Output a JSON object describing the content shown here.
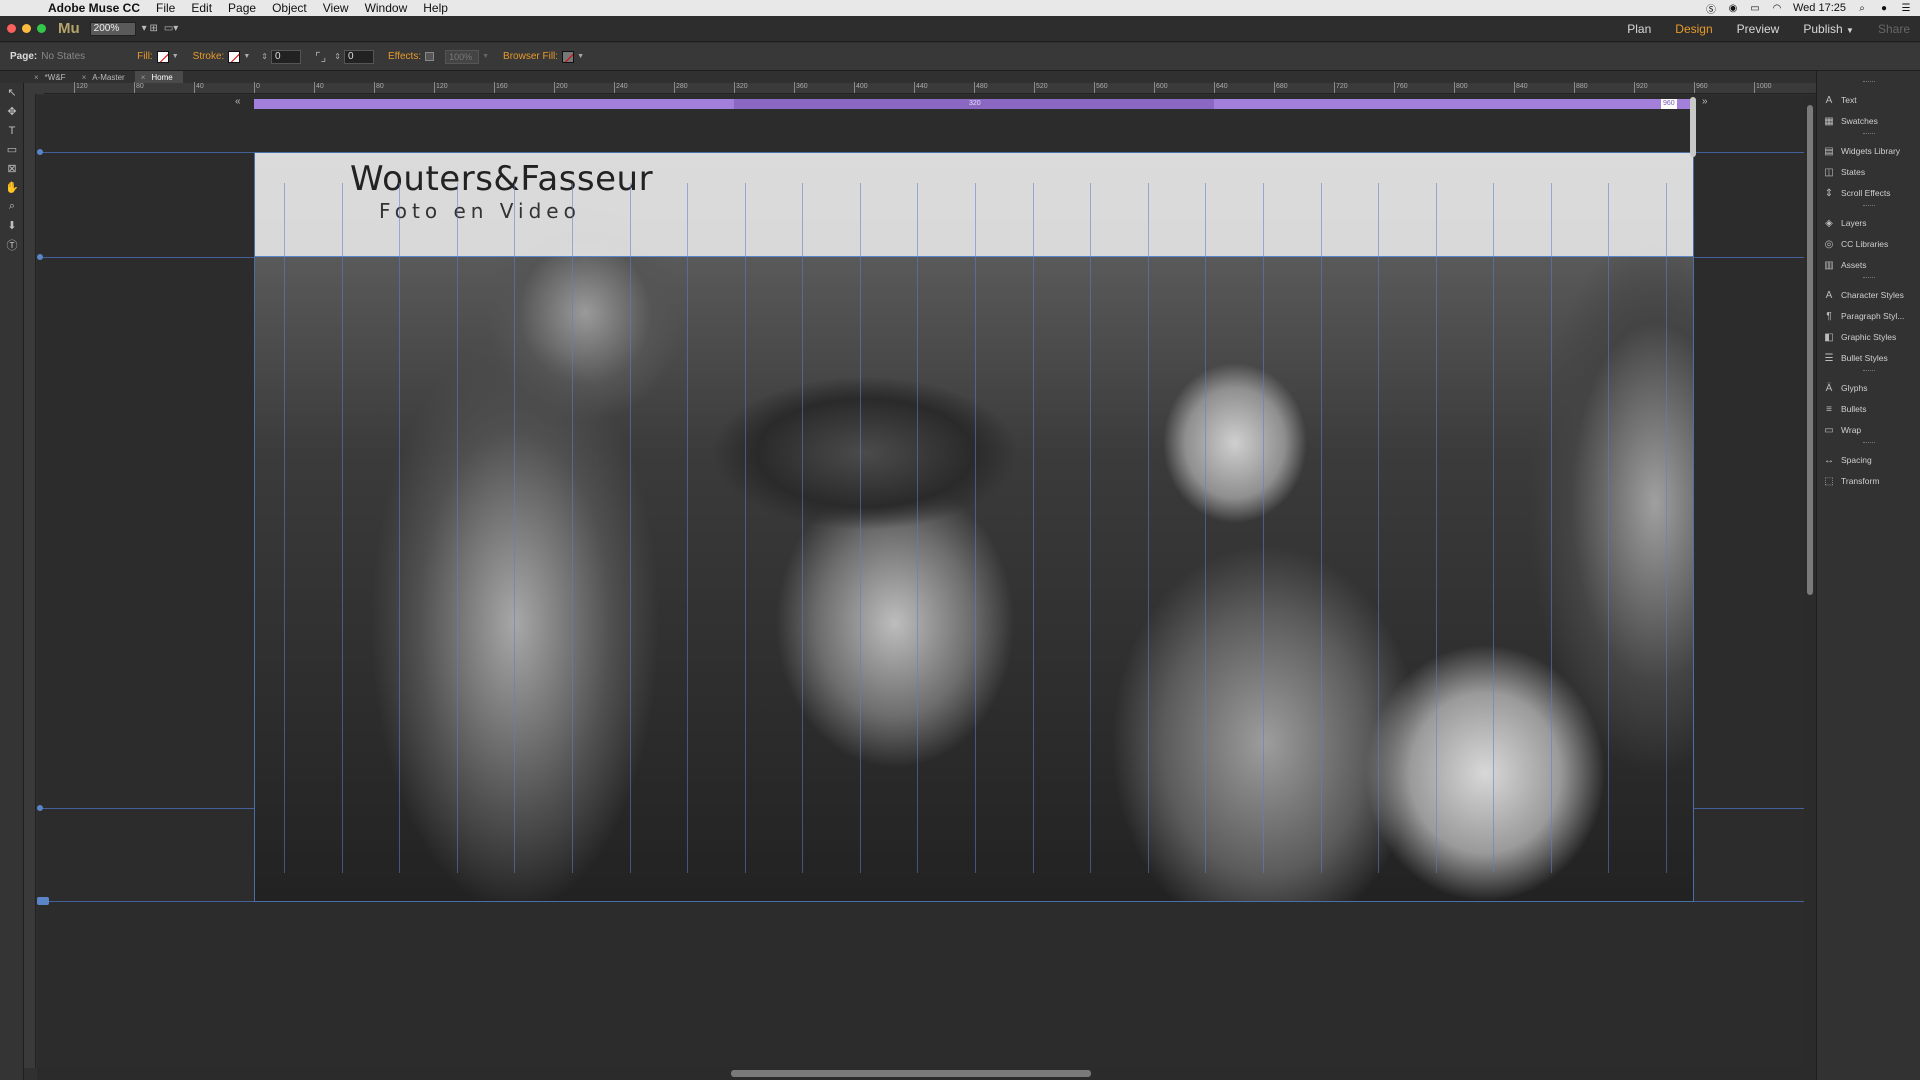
{
  "menubar": {
    "app_name": "Adobe Muse CC",
    "items": [
      "File",
      "Edit",
      "Page",
      "Object",
      "View",
      "Window",
      "Help"
    ],
    "clock": "Wed 17:25"
  },
  "modebar": {
    "logo": "Mu",
    "zoom": "200%",
    "modes": [
      "Plan",
      "Design",
      "Preview",
      "Publish",
      "Share"
    ],
    "active_mode": "Design"
  },
  "controls": {
    "page_label": "Page:",
    "page_state": "No States",
    "fill_label": "Fill:",
    "stroke_label": "Stroke:",
    "stroke_width": "0",
    "corner_radius": "0",
    "effects_label": "Effects:",
    "opacity": "100%",
    "browser_fill_label": "Browser Fill:"
  },
  "tabs": [
    {
      "label": "*W&F",
      "active": false
    },
    {
      "label": "A-Master",
      "active": false
    },
    {
      "label": "Home",
      "active": true
    }
  ],
  "ruler": {
    "labels": [
      "120",
      "80",
      "40",
      "0",
      "40",
      "80",
      "120",
      "160",
      "200",
      "240",
      "280",
      "320",
      "360",
      "400",
      "440",
      "480",
      "520",
      "560",
      "600",
      "640",
      "680",
      "720",
      "760",
      "800",
      "840",
      "880",
      "920",
      "960",
      "1000"
    ]
  },
  "breakpoint": {
    "mid_label": "320",
    "end_label": "960"
  },
  "site": {
    "title": "Wouters&Fasseur",
    "subtitle": "Foto en Video"
  },
  "panel": {
    "items": [
      {
        "label": "Text",
        "icon": "text-icon",
        "glyph": "A"
      },
      {
        "label": "Swatches",
        "icon": "swatches-icon",
        "glyph": "▦"
      },
      {
        "label": "Widgets Library",
        "icon": "widgets-icon",
        "glyph": "▤"
      },
      {
        "label": "States",
        "icon": "states-icon",
        "glyph": "◫"
      },
      {
        "label": "Scroll Effects",
        "icon": "scroll-effects-icon",
        "glyph": "⇕"
      },
      {
        "label": "Layers",
        "icon": "layers-icon",
        "glyph": "◈"
      },
      {
        "label": "CC Libraries",
        "icon": "cc-libraries-icon",
        "glyph": "◎"
      },
      {
        "label": "Assets",
        "icon": "assets-icon",
        "glyph": "▥"
      },
      {
        "label": "Character Styles",
        "icon": "character-styles-icon",
        "glyph": "A"
      },
      {
        "label": "Paragraph Styl...",
        "icon": "paragraph-styles-icon",
        "glyph": "¶"
      },
      {
        "label": "Graphic Styles",
        "icon": "graphic-styles-icon",
        "glyph": "◧"
      },
      {
        "label": "Bullet Styles",
        "icon": "bullet-styles-icon",
        "glyph": "☰"
      },
      {
        "label": "Glyphs",
        "icon": "glyphs-icon",
        "glyph": "Ä"
      },
      {
        "label": "Bullets",
        "icon": "bullets-icon",
        "glyph": "≡"
      },
      {
        "label": "Wrap",
        "icon": "wrap-icon",
        "glyph": "▭"
      },
      {
        "label": "Spacing",
        "icon": "spacing-icon",
        "glyph": "↔"
      },
      {
        "label": "Transform",
        "icon": "transform-icon",
        "glyph": "⬚"
      }
    ]
  },
  "colors": {
    "accent": "#e79a2b",
    "breakpoint": "#a27fd9",
    "guide": "#5a86c8"
  }
}
